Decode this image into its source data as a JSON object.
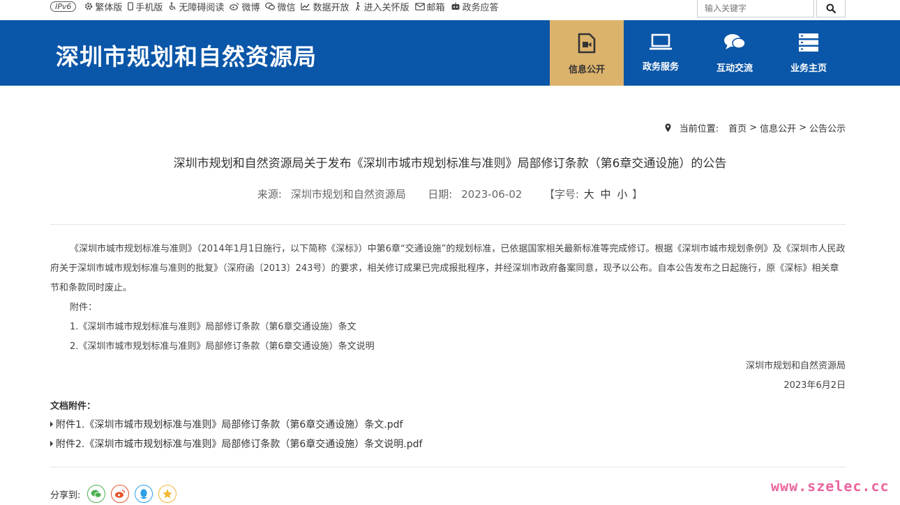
{
  "topbar": {
    "ipv6": "IPv6",
    "links": [
      "繁体版",
      "手机版",
      "无障碍阅读",
      "微博",
      "微信",
      "数据开放",
      "进入关怀版",
      "邮箱",
      "政务应答"
    ],
    "search_placeholder": "输入关键字"
  },
  "header": {
    "site_title": "深圳市规划和自然资源局",
    "nav": [
      "信息公开",
      "政务服务",
      "互动交流",
      "业务主页"
    ]
  },
  "breadcrumb": {
    "label": "当前位置:",
    "items": [
      "首页",
      "信息公开",
      "公告公示"
    ]
  },
  "article": {
    "title": "深圳市规划和自然资源局关于发布《深圳市城市规划标准与准则》局部修订条款（第6章交通设施）的公告",
    "source_label": "来源:",
    "source": "深圳市规划和自然资源局",
    "date_label": "日期:",
    "date": "2023-06-02",
    "font_label": "【字号:",
    "font_sizes": [
      "大",
      "中",
      "小"
    ],
    "font_end": "】",
    "paragraph": "《深圳市城市规划标准与准则》（2014年1月1日施行，以下简称《深标》）中第6章“交通设施”的规划标准，已依据国家相关最新标准等完成修订。根据《深圳市城市规划条例》及《深圳市人民政府关于深圳市城市规划标准与准则的批复》（深府函〔2013〕243号）的要求，相关修订成果已完成报批程序，并经深圳市政府备案同意，现予以公布。自本公告发布之日起施行，原《深标》相关章节和条款同时废止。",
    "attachments_label": "附件：",
    "attachment_lines": [
      "1.《深圳市城市规划标准与准则》局部修订条款（第6章交通设施）条文",
      "2.《深圳市城市规划标准与准则》局部修订条款（第6章交通设施）条文说明"
    ],
    "signature": "深圳市规划和自然资源局",
    "sign_date": "2023年6月2日"
  },
  "files": {
    "heading": "文档附件：",
    "items": [
      "附件1.《深圳市城市规划标准与准则》局部修订条款（第6章交通设施）条文.pdf",
      "附件2.《深圳市城市规划标准与准则》局部修订条款（第6章交通设施）条文说明.pdf"
    ]
  },
  "share": {
    "label": "分享到:",
    "icons": [
      "wechat-icon",
      "weibo-icon",
      "qq-icon",
      "qzone-icon"
    ]
  },
  "watermark": "www.szelec.cc",
  "colors": {
    "header_blue": "#0a56a8",
    "nav_active": "#dcb36c",
    "wechat": "#4caf50",
    "weibo": "#e8552c",
    "qq": "#2b9fe6",
    "qzone": "#f2b733"
  }
}
